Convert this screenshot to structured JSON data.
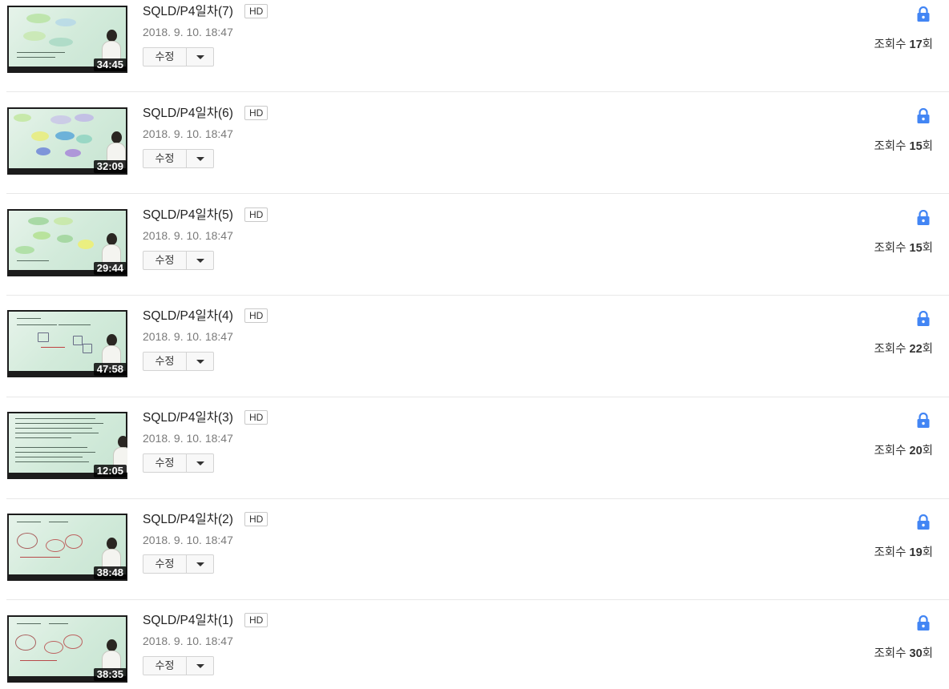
{
  "colors": {
    "lock": "#4285f4",
    "divider": "#e8e8e8",
    "duration_bg": "#000000"
  },
  "videos": [
    {
      "title": "SQLD/P4일차(7)",
      "quality": "HD",
      "date": "2018. 9. 10. 18:47",
      "duration": "34:45",
      "edit_label": "수정",
      "views_prefix": "조회수 ",
      "views_count": "17",
      "views_suffix": "회",
      "privacy_icon": "lock-icon"
    },
    {
      "title": "SQLD/P4일차(6)",
      "quality": "HD",
      "date": "2018. 9. 10. 18:47",
      "duration": "32:09",
      "edit_label": "수정",
      "views_prefix": "조회수 ",
      "views_count": "15",
      "views_suffix": "회",
      "privacy_icon": "lock-icon"
    },
    {
      "title": "SQLD/P4일차(5)",
      "quality": "HD",
      "date": "2018. 9. 10. 18:47",
      "duration": "29:44",
      "edit_label": "수정",
      "views_prefix": "조회수 ",
      "views_count": "15",
      "views_suffix": "회",
      "privacy_icon": "lock-icon"
    },
    {
      "title": "SQLD/P4일차(4)",
      "quality": "HD",
      "date": "2018. 9. 10. 18:47",
      "duration": "47:58",
      "edit_label": "수정",
      "views_prefix": "조회수 ",
      "views_count": "22",
      "views_suffix": "회",
      "privacy_icon": "lock-icon"
    },
    {
      "title": "SQLD/P4일차(3)",
      "quality": "HD",
      "date": "2018. 9. 10. 18:47",
      "duration": "12:05",
      "edit_label": "수정",
      "views_prefix": "조회수 ",
      "views_count": "20",
      "views_suffix": "회",
      "privacy_icon": "lock-icon"
    },
    {
      "title": "SQLD/P4일차(2)",
      "quality": "HD",
      "date": "2018. 9. 10. 18:47",
      "duration": "38:48",
      "edit_label": "수정",
      "views_prefix": "조회수 ",
      "views_count": "19",
      "views_suffix": "회",
      "privacy_icon": "lock-icon"
    },
    {
      "title": "SQLD/P4일차(1)",
      "quality": "HD",
      "date": "2018. 9. 10. 18:47",
      "duration": "38:35",
      "edit_label": "수정",
      "views_prefix": "조회수 ",
      "views_count": "30",
      "views_suffix": "회",
      "privacy_icon": "lock-icon"
    }
  ]
}
